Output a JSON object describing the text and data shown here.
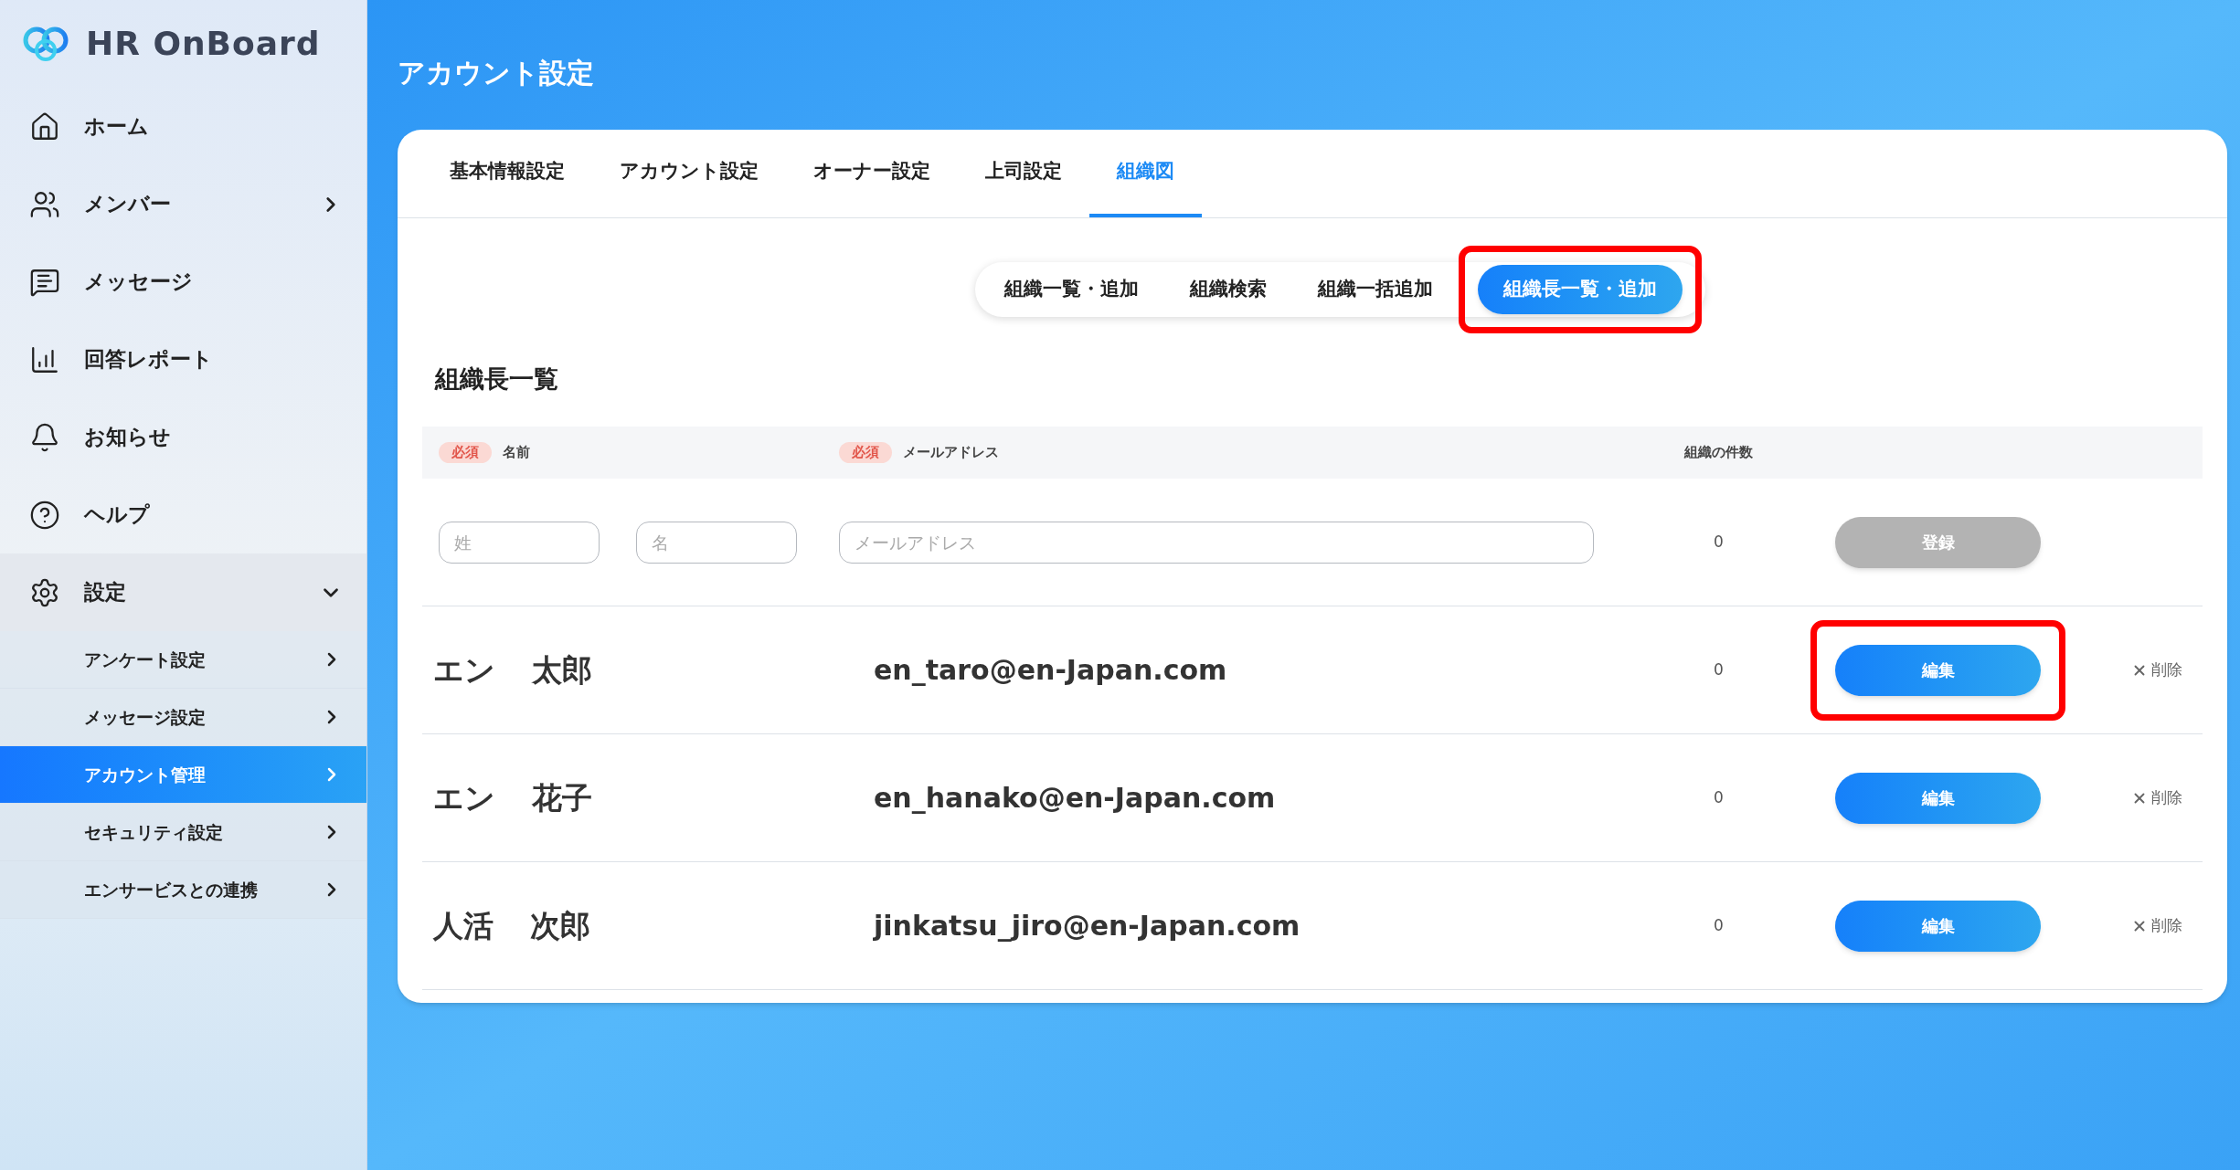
{
  "logo": {
    "text": "HR OnBoard"
  },
  "sidebar": {
    "items": [
      {
        "label": "ホーム",
        "has_arrow": false
      },
      {
        "label": "メンバー",
        "has_arrow": true
      },
      {
        "label": "メッセージ",
        "has_arrow": false
      },
      {
        "label": "回答レポート",
        "has_arrow": false
      },
      {
        "label": "お知らせ",
        "has_arrow": false
      },
      {
        "label": "ヘルプ",
        "has_arrow": false
      },
      {
        "label": "設定",
        "has_arrow": true,
        "expanded": true,
        "children": [
          {
            "label": "アンケート設定",
            "selected": false
          },
          {
            "label": "メッセージ設定",
            "selected": false
          },
          {
            "label": "アカウント管理",
            "selected": true
          },
          {
            "label": "セキュリティ設定",
            "selected": false
          },
          {
            "label": "エンサービスとの連携",
            "selected": false
          }
        ]
      }
    ]
  },
  "page_title": "アカウント設定",
  "tabs": [
    {
      "label": "基本情報設定",
      "selected": false
    },
    {
      "label": "アカウント設定",
      "selected": false
    },
    {
      "label": "オーナー設定",
      "selected": false
    },
    {
      "label": "上司設定",
      "selected": false
    },
    {
      "label": "組織図",
      "selected": true
    }
  ],
  "subtabs": [
    {
      "label": "組織一覧・追加",
      "selected": false,
      "highlighted": false
    },
    {
      "label": "組織検索",
      "selected": false,
      "highlighted": false
    },
    {
      "label": "組織一括追加",
      "selected": false,
      "highlighted": false
    },
    {
      "label": "組織長一覧・追加",
      "selected": true,
      "highlighted": true
    }
  ],
  "section_title": "組織長一覧",
  "table": {
    "header": {
      "required_badge_1": "必須",
      "name": "名前",
      "required_badge_2": "必須",
      "email": "メールアドレス",
      "count": "組織の件数"
    },
    "form": {
      "last_name_placeholder": "姓",
      "first_name_placeholder": "名",
      "email_placeholder": "メールアドレス",
      "count": "0",
      "submit": "登録",
      "submit_disabled": true
    },
    "rows": [
      {
        "last_name": "エン",
        "first_name": "太郎",
        "email": "en_taro@en-Japan.com",
        "count": "0",
        "edit": "編集",
        "delete": "削除",
        "highlighted": true
      },
      {
        "last_name": "エン",
        "first_name": "花子",
        "email": "en_hanako@en-Japan.com",
        "count": "0",
        "edit": "編集",
        "delete": "削除",
        "highlighted": false
      },
      {
        "last_name": "人活",
        "first_name": "次郎",
        "email": "jinkatsu_jiro@en-Japan.com",
        "count": "0",
        "edit": "編集",
        "delete": "削除",
        "highlighted": false
      }
    ]
  }
}
